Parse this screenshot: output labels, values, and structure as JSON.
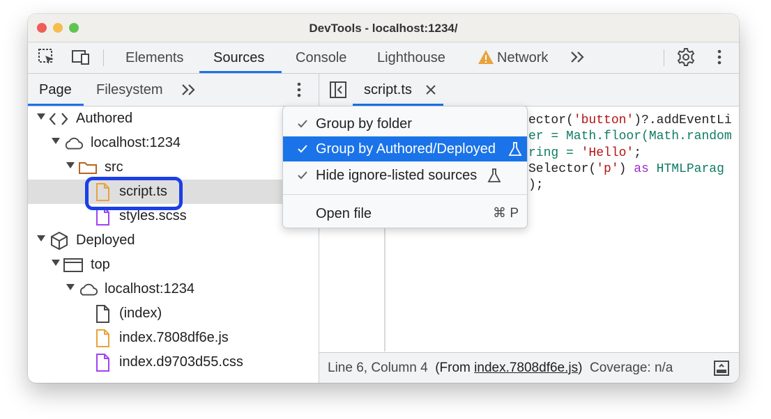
{
  "window": {
    "title": "DevTools - localhost:1234/"
  },
  "toolbar": {
    "tabs": [
      "Elements",
      "Sources",
      "Console",
      "Lighthouse",
      "Network"
    ],
    "active_tab": "Sources"
  },
  "navigator": {
    "tabs": [
      "Page",
      "Filesystem"
    ],
    "active_tab": "Page",
    "tree": [
      {
        "label": "Authored",
        "icon": "code-brackets-icon"
      },
      {
        "label": "localhost:1234",
        "icon": "cloud-icon"
      },
      {
        "label": "src",
        "icon": "folder-icon"
      },
      {
        "label": "script.ts",
        "icon": "file-icon",
        "color": "#e8a33d",
        "selected": true
      },
      {
        "label": "styles.scss",
        "icon": "file-icon",
        "color": "#a142f4"
      },
      {
        "label": "Deployed",
        "icon": "cube-icon"
      },
      {
        "label": "top",
        "icon": "frame-icon"
      },
      {
        "label": "localhost:1234",
        "icon": "cloud-icon"
      },
      {
        "label": "(index)",
        "icon": "file-icon",
        "color": "#474747"
      },
      {
        "label": "index.7808df6e.js",
        "icon": "file-icon",
        "color": "#e8a33d"
      },
      {
        "label": "index.d9703d55.css",
        "icon": "file-icon",
        "color": "#a142f4"
      }
    ]
  },
  "editor": {
    "tab_label": "script.ts",
    "code_fragments": [
      [
        "ector(",
        "'button'",
        ")?.addEventLi"
      ],
      [
        "er = Math.floor(Math.random"
      ],
      [
        "ring = ",
        "'Hello'",
        ";"
      ],
      [
        "Selector(",
        "'p'",
        ") ",
        "as",
        " ",
        "HTMLParag"
      ],
      [
        ");"
      ]
    ]
  },
  "status": {
    "position": "Line 6, Column 4",
    "from_prefix": "(From ",
    "from_link": "index.7808df6e.js",
    "from_suffix": ")",
    "coverage": "Coverage: n/a"
  },
  "context_menu": {
    "items": [
      {
        "label": "Group by folder",
        "checked": true,
        "experimental": false
      },
      {
        "label": "Group by Authored/Deployed",
        "checked": true,
        "experimental": true,
        "active": true
      },
      {
        "label": "Hide ignore-listed sources",
        "checked": true,
        "experimental": true
      }
    ],
    "open_file_label": "Open file",
    "open_file_shortcut": "⌘ P"
  },
  "colors": {
    "accent": "#1a73e8",
    "highlight_box": "#1b3fe6",
    "warning": "#e8a33d"
  }
}
